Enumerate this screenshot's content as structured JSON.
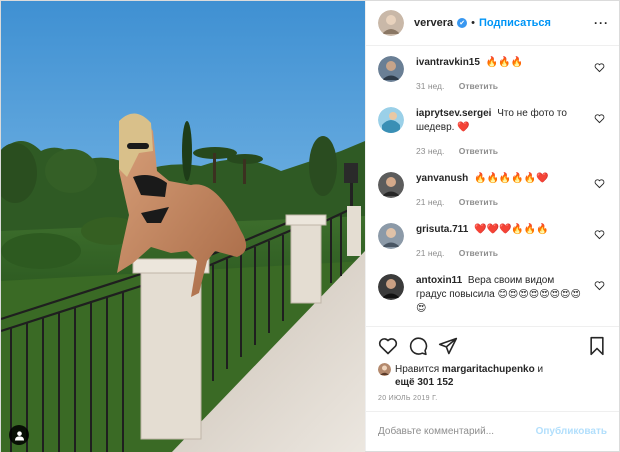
{
  "header": {
    "username": "ververa",
    "verified_mark": "✔",
    "separator": "•",
    "follow_label": "Подписаться",
    "more_label": "···"
  },
  "comments": [
    {
      "user": "ivantravkin15",
      "text": "🔥🔥🔥",
      "age": "31 нед.",
      "reply": "Ответить"
    },
    {
      "user": "iaprytsev.sergei",
      "text": "Что не фото то шедевр. ❤️",
      "age": "23 нед.",
      "reply": "Ответить"
    },
    {
      "user": "yanvanush",
      "text": "🔥🔥🔥🔥🔥❤️",
      "age": "21 нед.",
      "reply": "Ответить"
    },
    {
      "user": "grisuta.711",
      "text": "❤️❤️❤️🔥🔥🔥",
      "age": "21 нед.",
      "reply": "Ответить"
    },
    {
      "user": "antoxin11",
      "text": "Вера своим видом градус повысила 😊😍😍😍😍😍😍😍😍",
      "age": "",
      "reply": ""
    }
  ],
  "likes": {
    "prefix": "Нравится",
    "user": "margaritachupenko",
    "mid": "и",
    "count_text": "ещё 301 152"
  },
  "date": "20 ИЮЛЬ 2019 Г.",
  "add_comment": {
    "placeholder": "Добавьте комментарий...",
    "publish_label": "Опубликовать"
  },
  "colors": {
    "accent": "#0095f6",
    "publish_disabled": "#b2dffc",
    "heart_red": "#ed4956"
  },
  "icons": [
    "heart-icon",
    "comment-icon",
    "share-icon",
    "bookmark-icon",
    "user-tag-icon",
    "verified-icon",
    "more-icon"
  ]
}
